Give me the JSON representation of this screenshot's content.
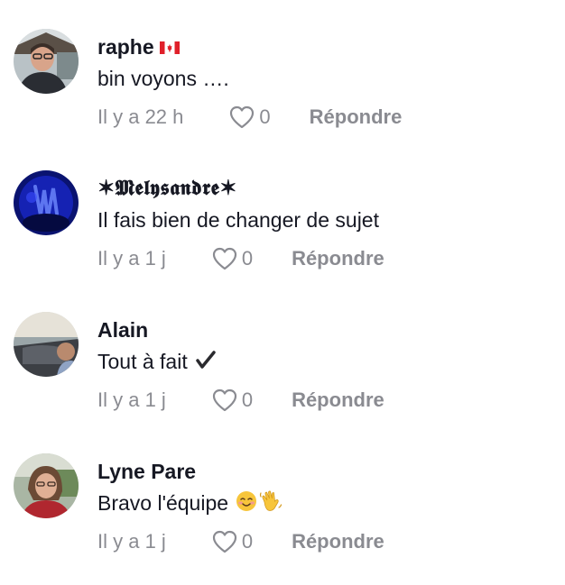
{
  "comments": [
    {
      "username": "raphe",
      "flag_icon": "canada-flag-icon",
      "text": "bin voyons ….",
      "time": "Il y a 22 h",
      "likes": "0",
      "reply_label": "Répondre"
    },
    {
      "username": "✶𝕸𝖊𝖑𝖞𝖘𝖆𝖓𝖉𝖗𝖊✶",
      "text": "Il fais bien de changer de sujet",
      "time": "Il y a 1 j",
      "likes": "0",
      "reply_label": "Répondre"
    },
    {
      "username": "Alain",
      "text": "Tout à fait",
      "text_icon": "check-mark-icon",
      "time": "Il y a 1 j",
      "likes": "0",
      "reply_label": "Répondre"
    },
    {
      "username": "Lyne Pare",
      "text": "Bravo l'équipe",
      "text_icons": [
        "smiling-face-icon",
        "waving-hand-icon"
      ],
      "time": "Il y a 1 j",
      "likes": "0",
      "reply_label": "Répondre"
    }
  ]
}
